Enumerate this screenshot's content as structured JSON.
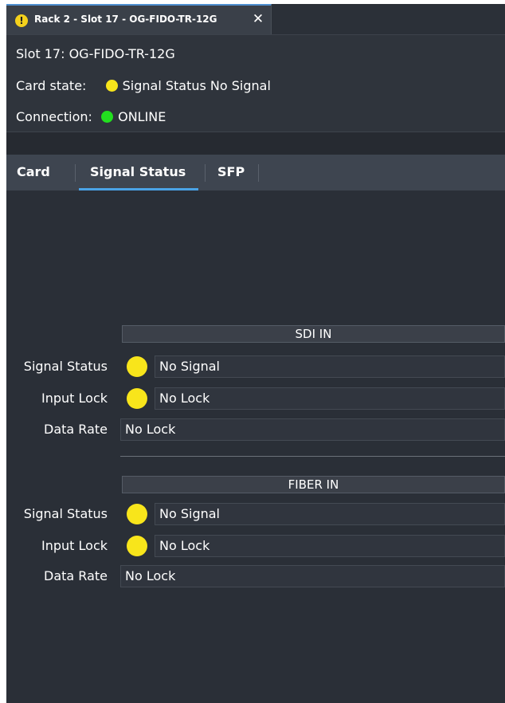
{
  "tab": {
    "title": "Rack 2 - Slot 17 - OG-FIDO-TR-12G",
    "status_icon": "warning-icon",
    "status_color": "#f4d11c"
  },
  "header": {
    "slot_line": "Slot 17: OG-FIDO-TR-12G",
    "card_state_label": "Card state:",
    "card_state_value": "Signal Status No Signal",
    "card_state_color": "#f8e51b",
    "connection_label": "Connection:",
    "connection_value": "ONLINE",
    "connection_color": "#22e01f"
  },
  "subtabs": [
    {
      "label": "Card",
      "active": false
    },
    {
      "label": "Signal Status",
      "active": true
    },
    {
      "label": "SFP",
      "active": false
    }
  ],
  "sections": [
    {
      "title": "SDI IN",
      "rows": [
        {
          "label": "Signal Status",
          "value": "No Signal",
          "indicator_color": "#f8e51b"
        },
        {
          "label": "Input Lock",
          "value": "No Lock",
          "indicator_color": "#f8e51b"
        },
        {
          "label": "Data Rate",
          "value": "No Lock"
        }
      ]
    },
    {
      "title": "FIBER IN",
      "rows": [
        {
          "label": "Signal Status",
          "value": "No Signal",
          "indicator_color": "#f8e51b"
        },
        {
          "label": "Input Lock",
          "value": "No Lock",
          "indicator_color": "#f8e51b"
        },
        {
          "label": "Data Rate",
          "value": "No Lock"
        }
      ]
    }
  ]
}
